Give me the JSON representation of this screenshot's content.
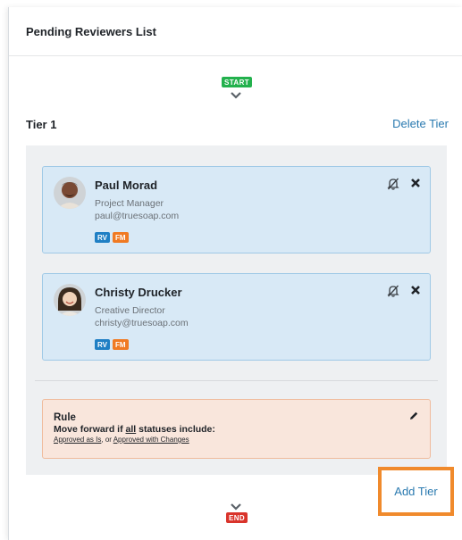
{
  "panel": {
    "title": "Pending Reviewers List"
  },
  "flow": {
    "start_label": "START",
    "end_label": "END"
  },
  "tier": {
    "label": "Tier 1",
    "delete_label": "Delete Tier",
    "reviewers": [
      {
        "name": "Paul Morad",
        "title": "Project Manager",
        "email": "paul@truesoap.com",
        "tags": [
          "RV",
          "FM"
        ]
      },
      {
        "name": "Christy Drucker",
        "title": "Creative Director",
        "email": "christy@truesoap.com",
        "tags": [
          "RV",
          "FM"
        ]
      }
    ],
    "rule": {
      "title": "Rule",
      "text_prefix": "Move forward if ",
      "text_emphasis": "all",
      "text_suffix": " statuses include:",
      "option_1": "Approved as Is",
      "separator": ", or ",
      "option_2": "Approved with Changes"
    }
  },
  "actions": {
    "add_tier_label": "Add Tier"
  },
  "colors": {
    "card_bg": "#d8e9f6",
    "rule_bg": "#f9e6dc",
    "link": "#2a7ab0",
    "start": "#23b14d",
    "end": "#d9342b",
    "tag_rv": "#1f7fc4",
    "tag_fm": "#f07a23",
    "highlight": "#f08a2c"
  },
  "icons": [
    "chevron-down-icon",
    "bell-off-icon",
    "close-icon",
    "pencil-icon"
  ]
}
